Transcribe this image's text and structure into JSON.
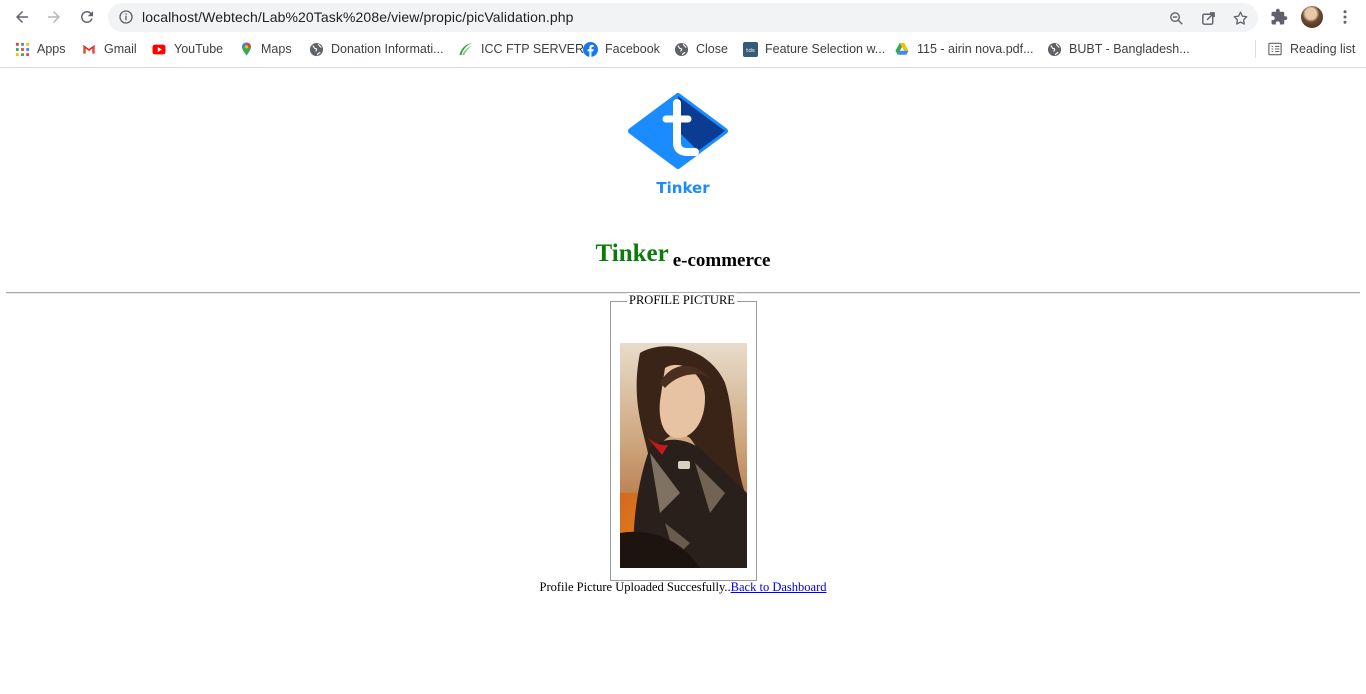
{
  "browser": {
    "url": "localhost/Webtech/Lab%20Task%208e/view/propic/picValidation.php",
    "reading_list_label": "Reading list",
    "bookmarks": [
      {
        "label": "Apps",
        "icon": "apps-grid-icon"
      },
      {
        "label": "Gmail",
        "icon": "gmail-icon"
      },
      {
        "label": "YouTube",
        "icon": "youtube-icon"
      },
      {
        "label": "Maps",
        "icon": "maps-pin-icon"
      },
      {
        "label": "Donation Informati...",
        "icon": "globe-icon"
      },
      {
        "label": "ICC FTP SERVER",
        "icon": "icc-leaf-icon"
      },
      {
        "label": "Facebook",
        "icon": "facebook-icon"
      },
      {
        "label": "Close",
        "icon": "globe-icon"
      },
      {
        "label": "Feature Selection w...",
        "icon": "tds-icon"
      },
      {
        "label": "115 - airin nova.pdf...",
        "icon": "google-drive-icon"
      },
      {
        "label": "BUBT - Bangladesh...",
        "icon": "globe-icon"
      }
    ]
  },
  "page": {
    "logo_text": "Tinker",
    "brand_title": "Tinker",
    "brand_subtitle": "e-commerce",
    "legend": "PROFILE PICTURE",
    "status_message": "Profile Picture Uploaded Succesfully..",
    "back_link": "Back to Dashboard"
  },
  "colors": {
    "brand_green": "#0b7b0b",
    "logo_blue_light": "#1a8cff",
    "logo_blue_dark": "#0a3d91",
    "link_blue": "#0000ee"
  }
}
